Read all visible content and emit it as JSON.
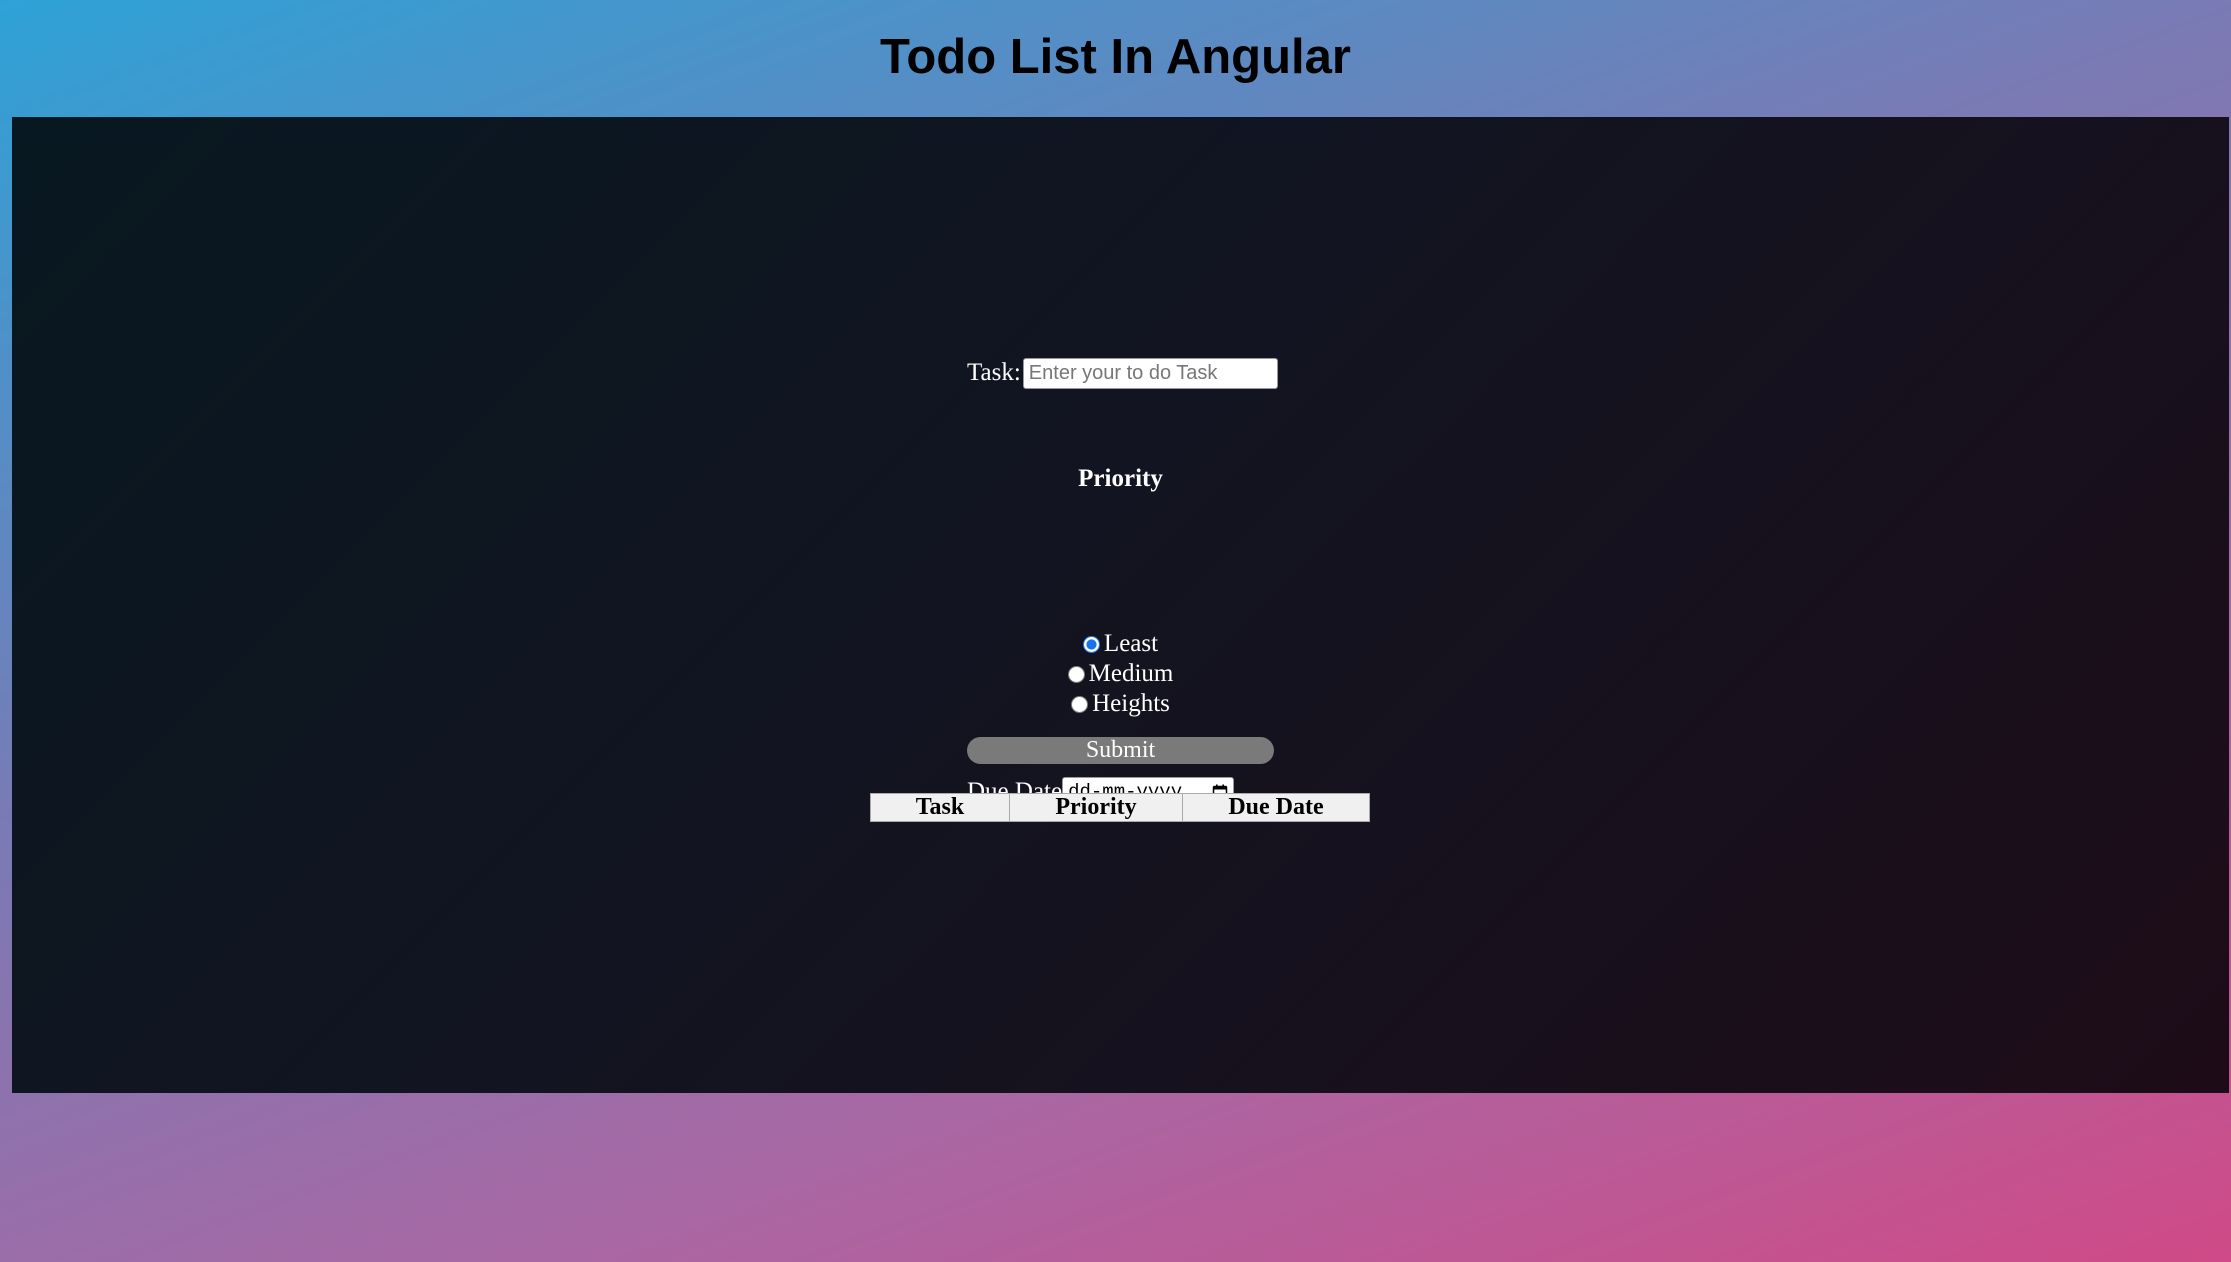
{
  "header": {
    "title": "Todo List In Angular"
  },
  "form": {
    "task_label": "Task:",
    "task_placeholder": "Enter your to do Task",
    "task_value": "",
    "priority_heading": "Priority",
    "priority_options": [
      {
        "label": "Least",
        "checked": true
      },
      {
        "label": "Medium",
        "checked": false
      },
      {
        "label": "Heights",
        "checked": false
      }
    ],
    "due_label": "Due Date",
    "due_placeholder": "dd-mm-yyyy",
    "submit_label": "Submit"
  },
  "table": {
    "columns": [
      "Task",
      "Priority",
      "Due Date"
    ],
    "rows": []
  },
  "colors": {
    "panel_background": "#121421",
    "submit_background": "#7a7a7a",
    "radio_accent": "#1a73e8"
  },
  "icons": {
    "date_picker": "calendar-icon"
  }
}
